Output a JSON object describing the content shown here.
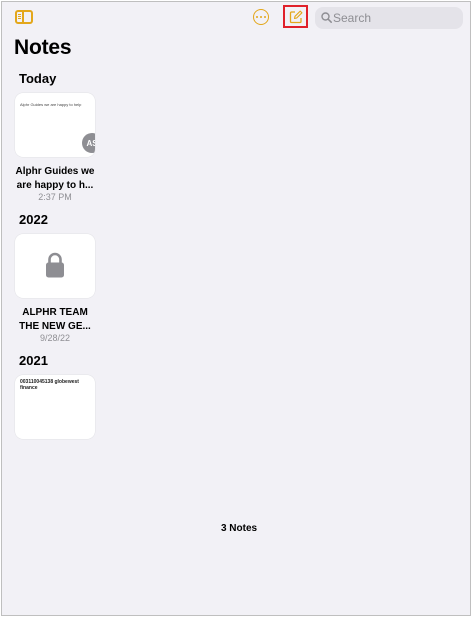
{
  "toolbar": {
    "search_placeholder": "Search"
  },
  "page": {
    "title": "Notes",
    "count_label": "3 Notes"
  },
  "sections": [
    {
      "label": "Today",
      "notes": [
        {
          "title_line1": "Alphr Guides we",
          "title_line2": "are happy to h...",
          "date": "2:37 PM",
          "preview": "Alphr Guides we are happy to help",
          "avatar_initials": "AS",
          "locked": false
        }
      ]
    },
    {
      "label": "2022",
      "notes": [
        {
          "title_line1": "ALPHR TEAM",
          "title_line2": "THE NEW GE...",
          "date": "9/28/22",
          "locked": true,
          "icon": "lock-icon"
        }
      ]
    },
    {
      "label": "2021",
      "notes": [
        {
          "preview": "003110045138 globewest finance",
          "locked": false
        }
      ]
    }
  ],
  "colors": {
    "accent": "#e3a71b",
    "highlight": "#e0202a",
    "background": "#f2f1f6"
  }
}
